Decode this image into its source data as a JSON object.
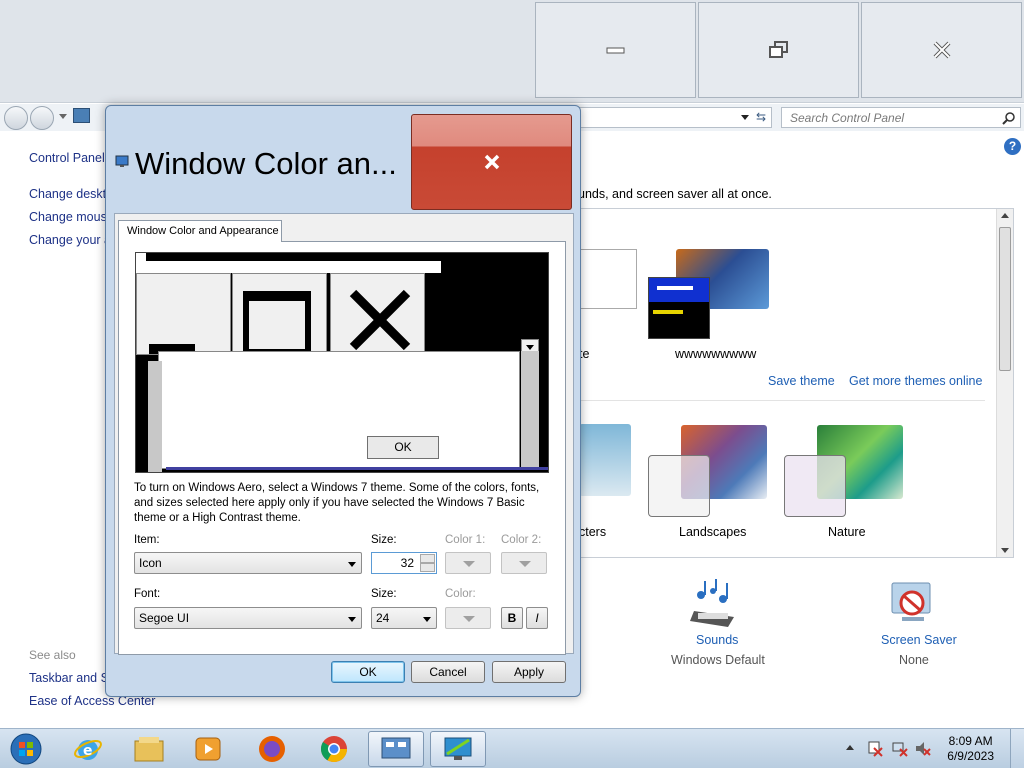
{
  "background_window": {
    "search_placeholder": "Search Control Panel",
    "sidebar": {
      "title": "Control Panel",
      "links": [
        "Change deskto",
        "Change mous",
        "Change your a"
      ],
      "see_also_label": "See also",
      "see_also_links": [
        "Taskbar and St",
        "Ease of Access Center"
      ]
    },
    "intro_text": "unds, and screen saver all at once.",
    "themes": {
      "partial_label": "te",
      "unsaved_theme_label": "wwwwwwwww",
      "save_theme": "Save theme",
      "get_more": "Get more themes online",
      "partial_group_label": "cters",
      "landscapes": "Landscapes",
      "nature": "Nature"
    },
    "bottom": {
      "sounds_label": "Sounds",
      "sounds_value": "Windows Default",
      "screensaver_label": "Screen Saver",
      "screensaver_value": "None"
    }
  },
  "dialog": {
    "title": "Window Color an...",
    "tab_label": "Window Color and Appearance",
    "preview": {
      "ok_label": "OK"
    },
    "description": "To turn on Windows Aero, select a Windows 7 theme.  Some of the colors, fonts, and sizes selected here apply only if you have selected the Windows 7 Basic theme or a High Contrast theme.",
    "item_label": "Item:",
    "item_value": "Icon",
    "size_label": "Size:",
    "size_value": "32",
    "color1_label": "Color 1:",
    "color2_label": "Color 2:",
    "font_label": "Font:",
    "font_value": "Segoe UI",
    "font_size_label": "Size:",
    "font_size_value": "24",
    "font_color_label": "Color:",
    "bold_label": "B",
    "italic_label": "I",
    "ok_button": "OK",
    "cancel_button": "Cancel",
    "apply_button": "Apply"
  },
  "taskbar": {
    "time": "8:09 AM",
    "date": "6/9/2023",
    "icons": [
      "start-orb",
      "internet-explorer-icon",
      "file-explorer-icon",
      "media-player-icon",
      "firefox-icon",
      "chrome-icon",
      "control-panel-icon",
      "display-settings-icon"
    ]
  },
  "colors": {
    "close_red": "#c94a36",
    "link_blue": "#1e5fb4",
    "dialog_frame": "#c8d9ec"
  }
}
